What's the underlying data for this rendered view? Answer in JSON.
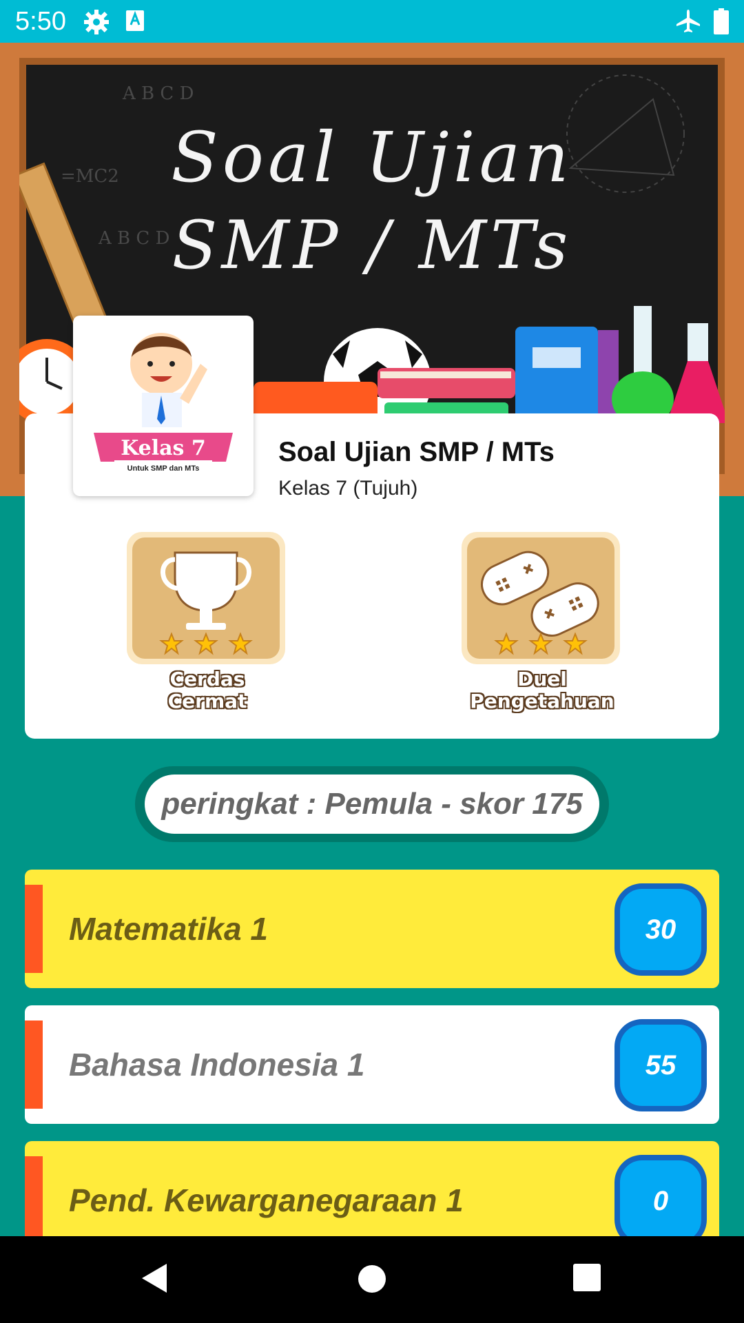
{
  "status_bar": {
    "time": "5:50",
    "icons": [
      "gear-icon",
      "a-keyboard-icon",
      "airplane-icon",
      "battery-icon"
    ]
  },
  "banner": {
    "title_line1": "Soal Ujian",
    "title_line2": "SMP / MTs"
  },
  "app_card": {
    "icon_label": "Kelas 7",
    "icon_sublabel": "Untuk SMP dan MTs",
    "title": "Soal Ujian SMP / MTs",
    "subtitle": "Kelas 7 (Tujuh)"
  },
  "modes": [
    {
      "label_line1": "Cerdas",
      "label_line2": "Cermat",
      "icon": "trophy-icon",
      "stars": 3
    },
    {
      "label_line1": "Duel",
      "label_line2": "Pengetahuan",
      "icon": "gamepad-icon",
      "stars": 3
    }
  ],
  "rank_text": "peringkat : Pemula - skor 175",
  "subjects": [
    {
      "name": "Matematika 1",
      "count": "30"
    },
    {
      "name": "Bahasa Indonesia 1",
      "count": "55"
    },
    {
      "name": "Pend. Kewarganegaraan 1",
      "count": "0"
    }
  ],
  "colors": {
    "status_bar": "#00BCD4",
    "background": "#009688",
    "accent": "#FF5722",
    "count_badge": "#03A9F4",
    "highlight_row": "#FFEB3B"
  },
  "nav_bar": {
    "buttons": [
      "back-icon",
      "home-icon",
      "recents-icon"
    ]
  }
}
